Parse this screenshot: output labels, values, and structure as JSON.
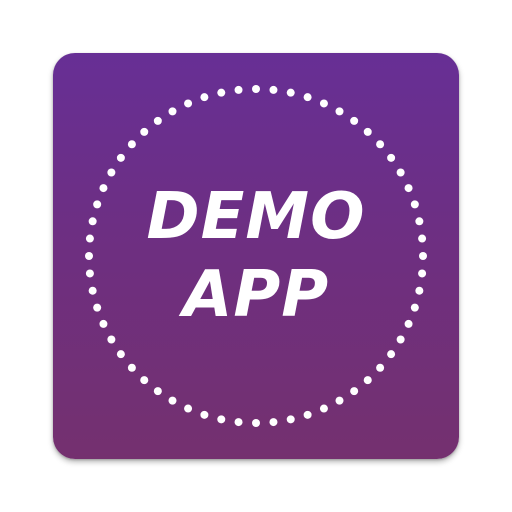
{
  "app_icon": {
    "line1": "DEMO",
    "line2": "APP",
    "background_gradient": [
      "#672f95",
      "#74306f"
    ],
    "text_color": "#ffffff",
    "dot_color": "#ffffff",
    "decoration": "dotted-ring-icon"
  }
}
